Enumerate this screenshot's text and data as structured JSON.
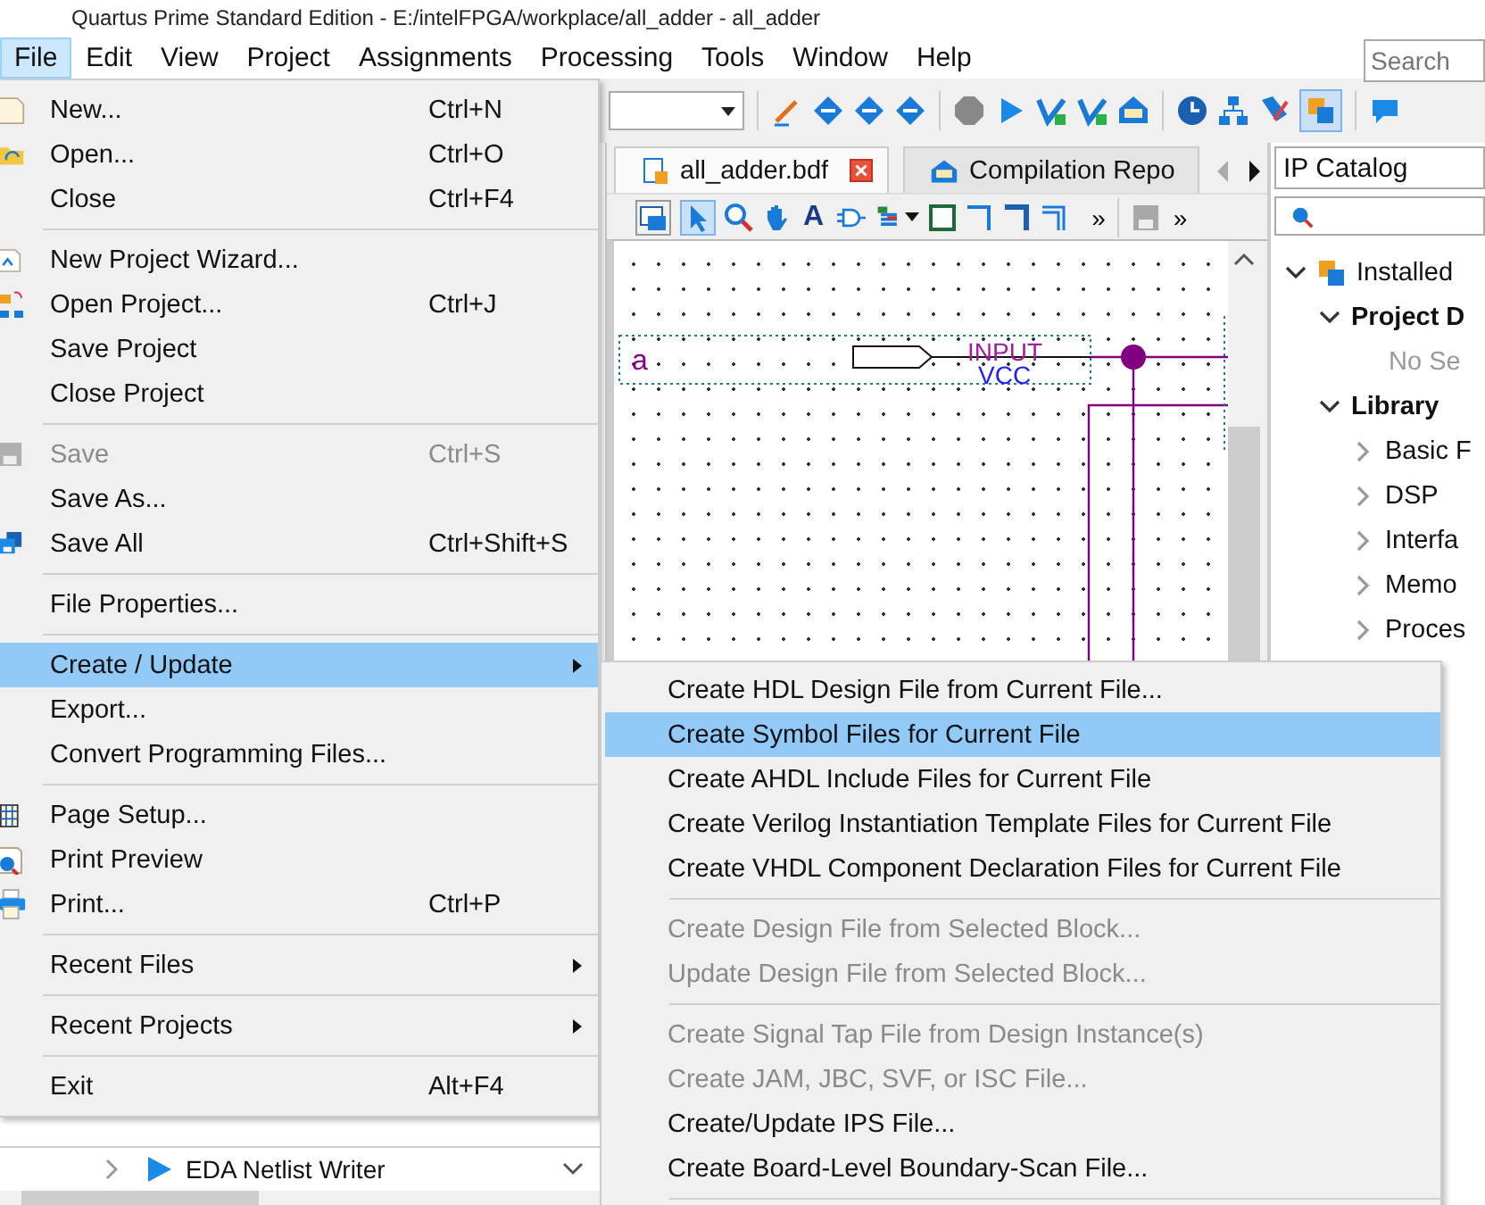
{
  "window": {
    "title": "Quartus Prime Standard Edition - E:/intelFPGA/workplace/all_adder - all_adder"
  },
  "menu_bar": [
    {
      "label": "File",
      "selected": true
    },
    {
      "label": "Edit",
      "selected": false
    },
    {
      "label": "View",
      "selected": false
    },
    {
      "label": "Project",
      "selected": false
    },
    {
      "label": "Assignments",
      "selected": false
    },
    {
      "label": "Processing",
      "selected": false
    },
    {
      "label": "Tools",
      "selected": false
    },
    {
      "label": "Window",
      "selected": false
    },
    {
      "label": "Help",
      "selected": false
    }
  ],
  "search": {
    "placeholder": "Search"
  },
  "editor_tabs": [
    {
      "label": "all_adder.bdf",
      "selected": true,
      "closable": true
    },
    {
      "label": "Compilation Repo",
      "selected": false,
      "closable": false
    }
  ],
  "editor_toolbar": {
    "text_tool": "A",
    "overflow": "»",
    "overflow_right": "»"
  },
  "schematic": {
    "pin_name": "a",
    "pin_type": "INPUT",
    "pin_default": "VCC"
  },
  "ip_catalog": {
    "title": "IP Catalog",
    "tree": [
      {
        "label": "Installed",
        "expanded": true,
        "children": [
          {
            "label": "Project D",
            "expanded": true,
            "children": [
              {
                "label": "No Se",
                "kind": "placeholder"
              }
            ]
          },
          {
            "label": "Library",
            "expanded": true,
            "children": [
              {
                "label": "Basic F",
                "expanded": false
              },
              {
                "label": "DSP",
                "expanded": false
              },
              {
                "label": "Interfa",
                "expanded": false
              },
              {
                "label": "Memo",
                "expanded": false
              },
              {
                "label": "Proces",
                "expanded": false
              }
            ]
          }
        ]
      }
    ]
  },
  "project_navigator": [
    {
      "label": "EDA Netlist Writer",
      "expanded": false
    }
  ],
  "file_menu": [
    {
      "kind": "item",
      "label": "New...",
      "shortcut": "Ctrl+N",
      "disabled": false,
      "selected": false
    },
    {
      "kind": "item",
      "label": "Open...",
      "shortcut": "Ctrl+O",
      "disabled": false,
      "selected": false
    },
    {
      "kind": "item",
      "label": "Close",
      "shortcut": "Ctrl+F4",
      "disabled": false,
      "selected": false
    },
    {
      "kind": "separator"
    },
    {
      "kind": "item",
      "label": "New Project Wizard...",
      "disabled": false,
      "selected": false
    },
    {
      "kind": "item",
      "label": "Open Project...",
      "shortcut": "Ctrl+J",
      "disabled": false,
      "selected": false
    },
    {
      "kind": "item",
      "label": "Save Project",
      "disabled": false,
      "selected": false
    },
    {
      "kind": "item",
      "label": "Close Project",
      "disabled": false,
      "selected": false
    },
    {
      "kind": "separator"
    },
    {
      "kind": "item",
      "label": "Save",
      "shortcut": "Ctrl+S",
      "disabled": true,
      "selected": false
    },
    {
      "kind": "item",
      "label": "Save As...",
      "disabled": false,
      "selected": false
    },
    {
      "kind": "item",
      "label": "Save All",
      "shortcut": "Ctrl+Shift+S",
      "disabled": false,
      "selected": false
    },
    {
      "kind": "separator"
    },
    {
      "kind": "item",
      "label": "File Properties...",
      "disabled": false,
      "selected": false
    },
    {
      "kind": "separator"
    },
    {
      "kind": "submenu",
      "label": "Create / Update",
      "disabled": false,
      "selected": true
    },
    {
      "kind": "item",
      "label": "Export...",
      "disabled": false,
      "selected": false
    },
    {
      "kind": "item",
      "label": "Convert Programming Files...",
      "disabled": false,
      "selected": false
    },
    {
      "kind": "separator"
    },
    {
      "kind": "item",
      "label": "Page Setup...",
      "disabled": false,
      "selected": false
    },
    {
      "kind": "item",
      "label": "Print Preview",
      "disabled": false,
      "selected": false
    },
    {
      "kind": "item",
      "label": "Print...",
      "shortcut": "Ctrl+P",
      "disabled": false,
      "selected": false
    },
    {
      "kind": "separator"
    },
    {
      "kind": "submenu",
      "label": "Recent Files",
      "disabled": false,
      "selected": false
    },
    {
      "kind": "separator"
    },
    {
      "kind": "submenu",
      "label": "Recent Projects",
      "disabled": false,
      "selected": false
    },
    {
      "kind": "separator"
    },
    {
      "kind": "item",
      "label": "Exit",
      "shortcut": "Alt+F4",
      "disabled": false,
      "selected": false
    }
  ],
  "create_update_submenu": [
    {
      "kind": "item",
      "label": "Create HDL Design File from Current File...",
      "disabled": false,
      "selected": false
    },
    {
      "kind": "item",
      "label": "Create Symbol Files for Current File",
      "disabled": false,
      "selected": true
    },
    {
      "kind": "item",
      "label": "Create AHDL Include Files for Current File",
      "disabled": false,
      "selected": false
    },
    {
      "kind": "item",
      "label": "Create Verilog Instantiation Template Files for Current File",
      "disabled": false,
      "selected": false
    },
    {
      "kind": "item",
      "label": "Create VHDL Component Declaration Files for Current File",
      "disabled": false,
      "selected": false
    },
    {
      "kind": "separator"
    },
    {
      "kind": "item",
      "label": "Create Design File from Selected Block...",
      "disabled": true,
      "selected": false
    },
    {
      "kind": "item",
      "label": "Update Design File from Selected Block...",
      "disabled": true,
      "selected": false
    },
    {
      "kind": "separator"
    },
    {
      "kind": "item",
      "label": "Create Signal Tap File from Design Instance(s)",
      "disabled": true,
      "selected": false
    },
    {
      "kind": "item",
      "label": "Create JAM, JBC, SVF, or ISC File...",
      "disabled": true,
      "selected": false
    },
    {
      "kind": "item",
      "label": "Create/Update IPS File...",
      "disabled": false,
      "selected": false
    },
    {
      "kind": "item",
      "label": "Create Board-Level Boundary-Scan File...",
      "disabled": false,
      "selected": false
    },
    {
      "kind": "separator"
    }
  ]
}
